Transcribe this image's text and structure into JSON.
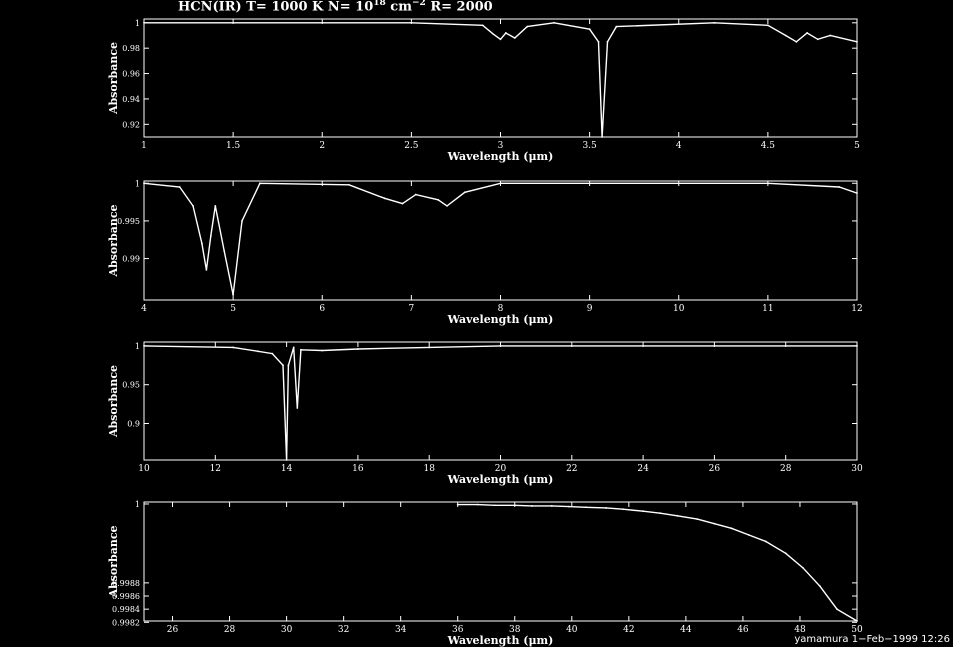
{
  "title": {
    "prefix": "HCN(IR) T= 1000 K N= 10",
    "n_exp": "18",
    "mid": " cm",
    "cm_exp": "−2",
    "suffix": " R= 2000"
  },
  "footer": "yamamura  1−Feb−1999 12:26",
  "colors": {
    "background": "#000000",
    "foreground": "#ffffff"
  },
  "chart_data": [
    {
      "type": "line",
      "xlabel": "Wavelength (μm)",
      "ylabel": "Absorbance",
      "xlim": [
        1,
        5
      ],
      "ylim": [
        0.91,
        1.003
      ],
      "xticks": [
        1,
        1.5,
        2,
        2.5,
        3,
        3.5,
        4,
        4.5,
        5
      ],
      "xtick_labels": [
        "1",
        "1.5",
        "2",
        "2.5",
        "3",
        "3.5",
        "4",
        "4.5",
        "5"
      ],
      "yticks": [
        0.92,
        0.94,
        0.96,
        0.98,
        1
      ],
      "ytick_labels": [
        "0.92",
        "0.94",
        "0.96",
        "0.98",
        "1"
      ],
      "x": [
        1,
        2.5,
        2.9,
        2.96,
        3.0,
        3.03,
        3.08,
        3.15,
        3.3,
        3.5,
        3.55,
        3.57,
        3.6,
        3.65,
        4.2,
        4.5,
        4.6,
        4.66,
        4.72,
        4.78,
        4.85,
        5
      ],
      "y": [
        1,
        1,
        0.998,
        0.991,
        0.987,
        0.992,
        0.988,
        0.997,
        1,
        0.995,
        0.985,
        0.91,
        0.985,
        0.997,
        1,
        0.998,
        0.99,
        0.985,
        0.992,
        0.987,
        0.99,
        0.985
      ]
    },
    {
      "type": "line",
      "xlabel": "Wavelength (μm)",
      "ylabel": "Absorbance",
      "xlim": [
        4,
        12
      ],
      "ylim": [
        0.9845,
        1.0003
      ],
      "xticks": [
        4,
        5,
        6,
        7,
        8,
        9,
        10,
        11,
        12
      ],
      "xtick_labels": [
        "4",
        "5",
        "6",
        "7",
        "8",
        "9",
        "10",
        "11",
        "12"
      ],
      "yticks": [
        0.99,
        0.995,
        1
      ],
      "ytick_labels": [
        "0.99",
        "0.995",
        "1"
      ],
      "x": [
        4,
        4.4,
        4.55,
        4.65,
        4.7,
        4.75,
        4.8,
        4.9,
        5.0,
        5.1,
        5.3,
        6.3,
        6.7,
        6.9,
        7.05,
        7.3,
        7.4,
        7.6,
        8.0,
        11.0,
        11.8,
        12
      ],
      "y": [
        1,
        0.9995,
        0.997,
        0.992,
        0.9885,
        0.993,
        0.997,
        0.991,
        0.9852,
        0.995,
        1,
        0.9998,
        0.998,
        0.9973,
        0.9985,
        0.9978,
        0.997,
        0.9988,
        1,
        1,
        0.9995,
        0.9987
      ]
    },
    {
      "type": "line",
      "xlabel": "Wavelength (μm)",
      "ylabel": "Absorbance",
      "xlim": [
        10,
        30
      ],
      "ylim": [
        0.853,
        1.005
      ],
      "xticks": [
        10,
        12,
        14,
        16,
        18,
        20,
        22,
        24,
        26,
        28,
        30
      ],
      "xtick_labels": [
        "10",
        "12",
        "14",
        "16",
        "18",
        "20",
        "22",
        "24",
        "26",
        "28",
        "30"
      ],
      "yticks": [
        0.9,
        0.95,
        1
      ],
      "ytick_labels": [
        "0.9",
        "0.95",
        "1"
      ],
      "x": [
        10,
        12.5,
        13.2,
        13.6,
        13.9,
        14.0,
        14.05,
        14.2,
        14.3,
        14.4,
        15,
        16,
        18,
        20,
        30
      ],
      "y": [
        1,
        0.998,
        0.993,
        0.99,
        0.975,
        0.853,
        0.975,
        0.998,
        0.92,
        0.995,
        0.994,
        0.996,
        0.998,
        1,
        1
      ]
    },
    {
      "type": "line",
      "xlabel": "Wavelength (μm)",
      "ylabel": "Absorbance",
      "xlim": [
        25,
        50
      ],
      "ylim": [
        0.99822,
        1.00003
      ],
      "xticks": [
        26,
        28,
        30,
        32,
        34,
        36,
        38,
        40,
        42,
        44,
        46,
        48,
        50
      ],
      "xtick_labels": [
        "26",
        "28",
        "30",
        "32",
        "34",
        "36",
        "38",
        "40",
        "42",
        "44",
        "46",
        "48",
        "50"
      ],
      "yticks": [
        0.9982,
        0.9984,
        0.9986,
        0.9988,
        1
      ],
      "ytick_labels": [
        "0.9982",
        "0.9984",
        "0.9986",
        "0.9988",
        "1"
      ],
      "x": [
        36,
        36.7,
        37.3,
        38,
        38.6,
        39.3,
        39.9,
        40.5,
        41.2,
        41.8,
        42.5,
        43.1,
        43.7,
        44.4,
        45.0,
        45.6,
        46.2,
        46.8,
        47.5,
        48.1,
        48.7,
        49.3,
        50
      ],
      "y": [
        0.99999,
        0.99999,
        0.99998,
        0.99998,
        0.99997,
        0.99997,
        0.99996,
        0.99995,
        0.99994,
        0.99992,
        0.99989,
        0.99986,
        0.99982,
        0.99977,
        0.9997,
        0.99963,
        0.99953,
        0.99943,
        0.99925,
        0.99903,
        0.99875,
        0.9984,
        0.99822
      ]
    }
  ]
}
